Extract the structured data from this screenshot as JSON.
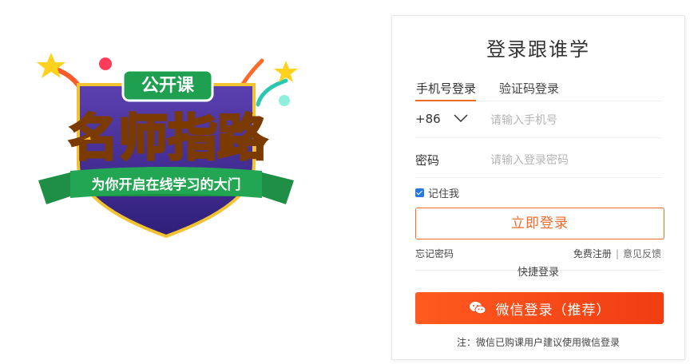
{
  "banner": {
    "badge": "公开课",
    "headline": "名师指路",
    "ribbon": "为你开启在线学习的大门"
  },
  "login": {
    "title": "登录跟谁学",
    "tabs": [
      {
        "label": "手机号登录",
        "active": true
      },
      {
        "label": "验证码登录",
        "active": false
      }
    ],
    "country_code": "+86",
    "phone_placeholder": "请输入手机号",
    "password_label": "密码",
    "password_placeholder": "请输入登录密码",
    "remember_label": "记住我",
    "remember_checked": true,
    "login_button": "立即登录",
    "forgot_link": "忘记密码",
    "register_link": "免费注册",
    "separator": "|",
    "feedback_link": "意见反馈",
    "quick_login_label": "快捷登录",
    "wechat_button": "微信登录（推荐）",
    "note": "注：微信已购课用户建议使用微信登录"
  },
  "colors": {
    "accent": "#f26a2a",
    "wechat_button": "#f2461a",
    "checkbox": "#2a79e3"
  },
  "icons": [
    "chevron-down-icon",
    "wechat-icon",
    "checkbox-checked-icon"
  ]
}
